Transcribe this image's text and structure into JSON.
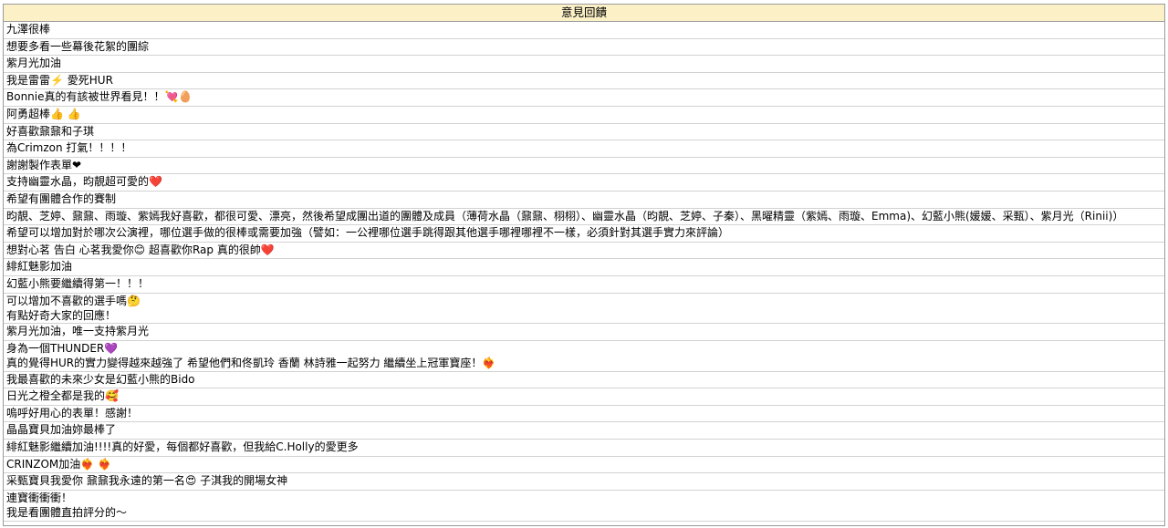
{
  "table": {
    "header": "意見回饋",
    "rows": [
      {
        "lines": [
          "九澤很棒"
        ]
      },
      {
        "lines": [
          "想要多看一些幕後花絮的團綜"
        ]
      },
      {
        "lines": [
          "紫月光加油"
        ]
      },
      {
        "lines": [
          "我是雷雷⚡️ 愛死HUR"
        ]
      },
      {
        "lines": [
          "Bonnie真的有該被世界看見！！💘🥚"
        ]
      },
      {
        "lines": [
          "阿勇超棒👍 👍"
        ]
      },
      {
        "lines": [
          "好喜歡鼐鼐和子琪"
        ]
      },
      {
        "lines": [
          "為Crimzon 打氣！！！！"
        ]
      },
      {
        "lines": [
          "謝謝製作表單❤"
        ]
      },
      {
        "lines": [
          "支持幽靈水晶，昀靚超可愛的❤️"
        ]
      },
      {
        "lines": [
          "希望有團體合作的賽制"
        ]
      },
      {
        "lines": [
          "昀靚、芝婷、鼐鼐、雨璇、紫嫣我好喜歡，都很可愛、漂亮，然後希望成團出道的團體及成員（薄荷水晶（鼐鼐、栩栩）、幽靈水晶（昀靚、芝婷、子秦）、黑曜精靈（紫嫣、雨璇、Emma)、幻藍小熊(媛媛、采甄）、紫月光（Rinii)）"
        ]
      },
      {
        "lines": [
          "希望可以增加對於哪次公演裡，哪位選手做的很棒或需要加強（譬如：一公裡哪位選手跳得跟其他選手哪裡哪裡不一樣，必須針對其選手實力來評論）"
        ]
      },
      {
        "lines": [
          "想對心茗 告白 心茗我愛你😊 超喜歡你Rap 真的很帥❤️"
        ]
      },
      {
        "lines": [
          "緋紅魅影加油"
        ]
      },
      {
        "lines": [
          "幻藍小熊要繼續得第一！！！"
        ]
      },
      {
        "lines": [
          "可以增加不喜歡的選手嗎🤔",
          "有點好奇大家的回應！"
        ]
      },
      {
        "lines": [
          "紫月光加油，唯一支持紫月光"
        ]
      },
      {
        "lines": [
          "身為一個THUNDER💜",
          "真的覺得HUR的實力變得越來越強了 希望他們和佟凱玲 香蘭 林詩雅一起努力 繼續坐上冠軍寶座！❤️‍🔥"
        ]
      },
      {
        "lines": [
          "我最喜歡的未來少女是幻藍小熊的Bido"
        ]
      },
      {
        "lines": [
          "日光之橙全都是我的🥰"
        ]
      },
      {
        "lines": [
          "嗚呼好用心的表單！感謝！"
        ]
      },
      {
        "lines": [
          "晶晶寶貝加油妳最棒了"
        ]
      },
      {
        "lines": [
          "緋紅魅影繼續加油!!!!真的好愛，每個都好喜歡，但我給C.Holly的愛更多"
        ]
      },
      {
        "lines": [
          "CRINZOM加油❤️‍🔥 ❤️‍🔥"
        ]
      },
      {
        "lines": [
          "采甄寶貝我愛你 鼐鼐我永遠的第一名😍 子淇我的開場女神"
        ]
      },
      {
        "lines": [
          "連寶衝衝衝！",
          "我是看團體直拍評分的～"
        ]
      }
    ]
  }
}
